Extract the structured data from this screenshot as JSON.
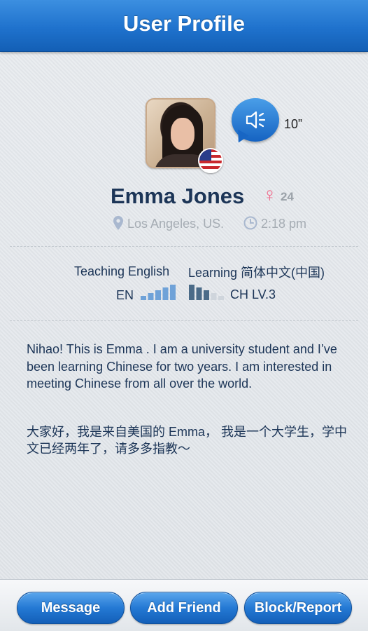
{
  "header": {
    "title": "User Profile"
  },
  "profile": {
    "name": "Emma Jones",
    "gender_symbol": "♀",
    "age": "24",
    "location": "Los Angeles, US.",
    "local_time": "2:18 pm",
    "flag": "us-flag-icon",
    "voice": {
      "duration": "10”"
    }
  },
  "languages": {
    "teaching_label": "Teaching English",
    "teaching_code": "EN",
    "teaching_level": 5,
    "learning_label": "Learning 简体中文(中国)",
    "learning_level_text": "CH LV.3",
    "learning_level": 3,
    "max_level": 5
  },
  "bio": {
    "english": "Nihao! This is Emma . I am a university student and I’ve been learning Chinese for two years. I am interested in meeting Chinese from all over the world.",
    "chinese": "大家好，我是来自美国的 Emma， 我是一个大学生，学中文已经两年了，请多多指教～"
  },
  "actions": {
    "message": "Message",
    "add_friend": "Add Friend",
    "block_report": "Block/Report"
  },
  "colors": {
    "accent": "#1f72cd",
    "name_text": "#1c3557",
    "gender": "#f06d8d"
  }
}
